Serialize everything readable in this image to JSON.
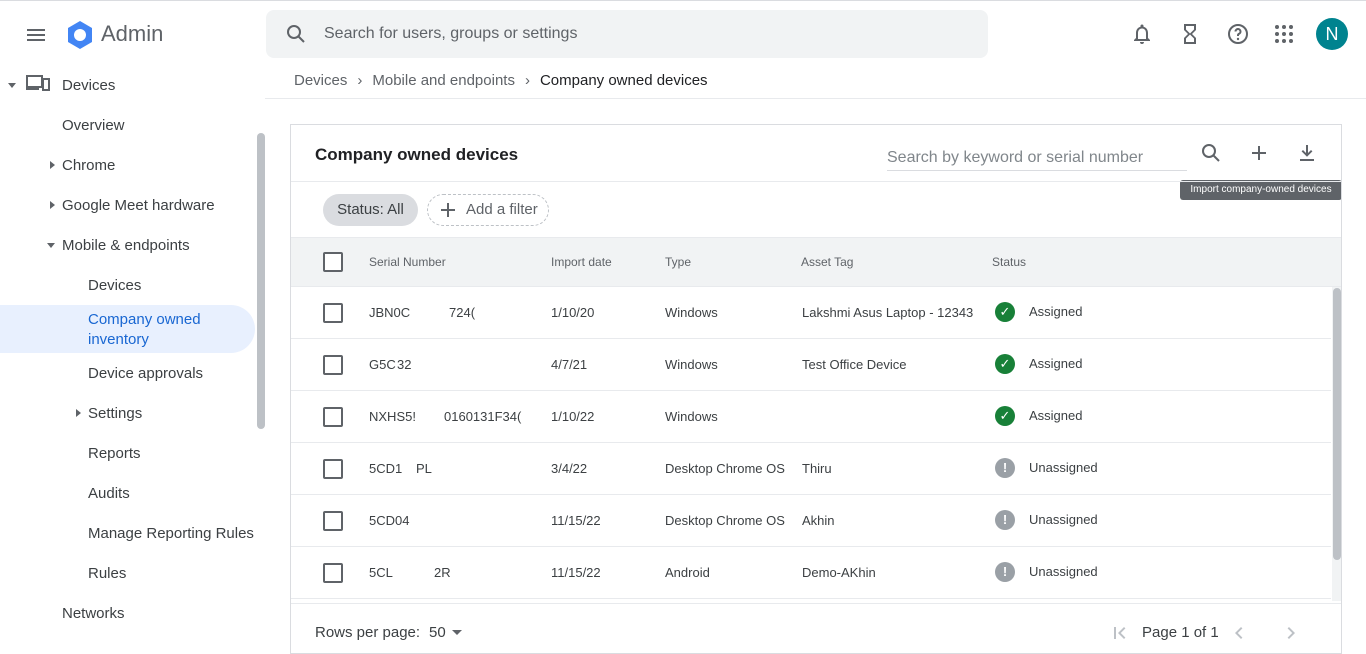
{
  "app": {
    "brand": "Admin",
    "avatar_letter": "N"
  },
  "search": {
    "placeholder": "Search for users, groups or settings"
  },
  "sidebar": {
    "root": "Devices",
    "items": [
      {
        "label": "Overview"
      },
      {
        "label": "Chrome"
      },
      {
        "label": "Google Meet hardware"
      },
      {
        "label": "Mobile & endpoints"
      },
      {
        "label": "Devices"
      },
      {
        "label": "Company owned inventory"
      },
      {
        "label": "Device approvals"
      },
      {
        "label": "Settings"
      },
      {
        "label": "Reports"
      },
      {
        "label": "Audits"
      },
      {
        "label": "Manage Reporting Rules"
      },
      {
        "label": "Rules"
      },
      {
        "label": "Networks"
      }
    ]
  },
  "breadcrumb": [
    "Devices",
    "Mobile and endpoints",
    "Company owned devices"
  ],
  "card": {
    "title": "Company owned devices",
    "search_placeholder": "Search by keyword or serial number",
    "tooltip": "Import company-owned devices",
    "status_chip": "Status: All",
    "add_filter": "Add a filter"
  },
  "table": {
    "headers": [
      "Serial Number",
      "Import date",
      "Type",
      "Asset Tag",
      "Status"
    ],
    "rows": [
      {
        "serial_a": "JBN0C",
        "serial_b": "724(",
        "date": "1/10/20",
        "type": "Windows",
        "asset": "Lakshmi Asus Laptop - 12343",
        "status": "Assigned"
      },
      {
        "serial_a": "G5C",
        "serial_b": "32",
        "date": "4/7/21",
        "type": "Windows",
        "asset": "Test Office Device",
        "status": "Assigned"
      },
      {
        "serial_a": "NXHS5!",
        "serial_b": "0160131F34(",
        "date": "1/10/22",
        "type": "Windows",
        "asset": "",
        "status": "Assigned"
      },
      {
        "serial_a": "5CD1",
        "serial_b": "PL",
        "date": "3/4/22",
        "type": "Desktop Chrome OS",
        "asset": "Thiru",
        "status": "Unassigned"
      },
      {
        "serial_a": "5CD04",
        "serial_b": "",
        "date": "11/15/22",
        "type": "Desktop Chrome OS",
        "asset": "Akhin",
        "status": "Unassigned"
      },
      {
        "serial_a": "5CL",
        "serial_b": "2R",
        "date": "11/15/22",
        "type": "Android",
        "asset": "Demo-AKhin",
        "status": "Unassigned"
      }
    ]
  },
  "footer": {
    "rows_per_page_label": "Rows per page:",
    "rows_per_page": "50",
    "page_info": "Page 1 of 1"
  },
  "colors": {
    "accent": "#1967d2",
    "assigned": "#188038",
    "unassigned": "#9aa0a6",
    "avatar": "#00838f"
  },
  "icons": [
    "menu-icon",
    "admin-logo-icon",
    "search-icon",
    "bell-icon",
    "hourglass-icon",
    "help-icon",
    "apps-icon",
    "add-icon",
    "download-icon",
    "check-circle-icon",
    "exclamation-circle-icon",
    "first-page-icon",
    "prev-page-icon",
    "next-page-icon"
  ]
}
